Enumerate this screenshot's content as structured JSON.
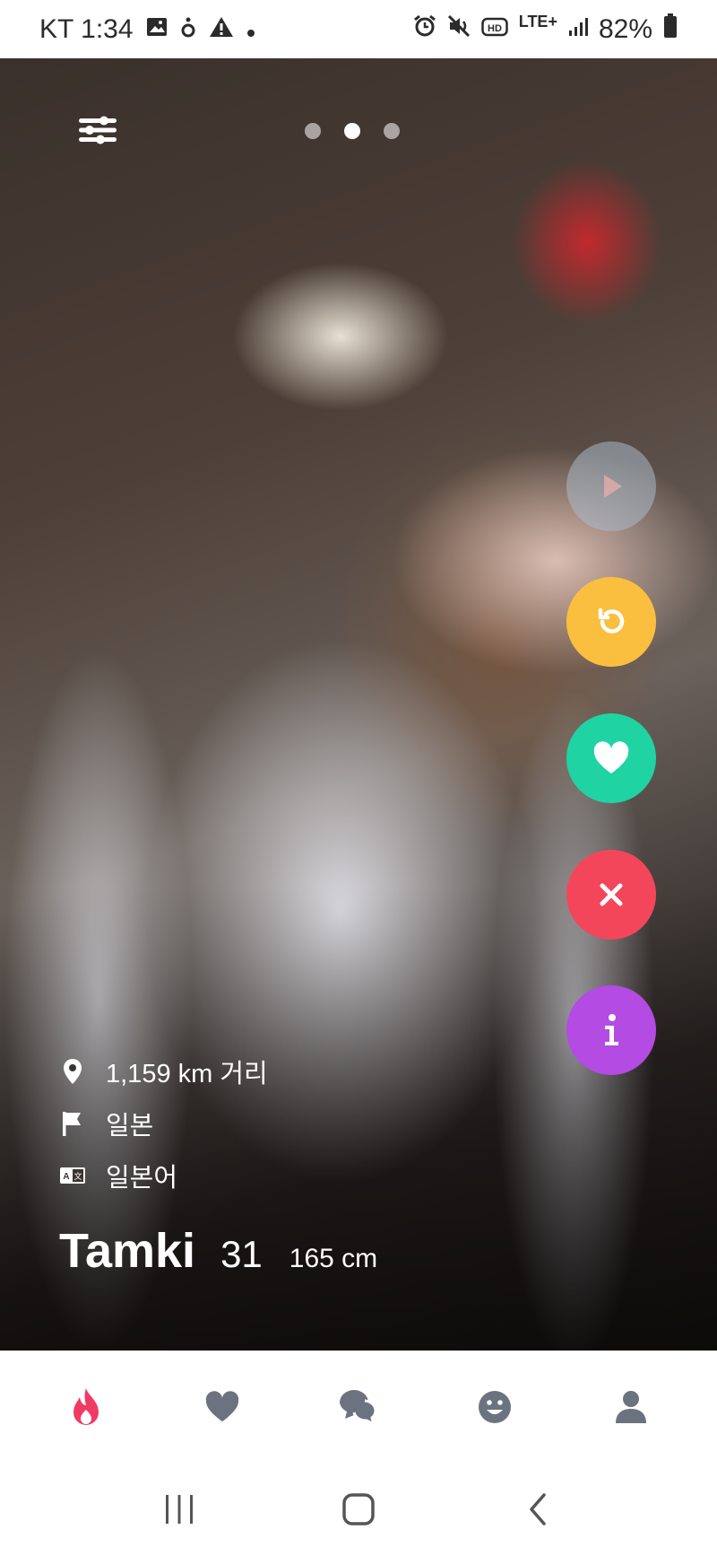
{
  "status_bar": {
    "carrier_time": "KT 1:34",
    "network": "LTE+",
    "battery": "82%"
  },
  "photo": {
    "page_indicator": {
      "count": 3,
      "active_index": 1
    }
  },
  "profile": {
    "distance": "1,159 km 거리",
    "country": "일본",
    "language": "일본어",
    "name": "Tamki",
    "age": "31",
    "height": "165 cm"
  },
  "colors": {
    "undo": "#fbbf3f",
    "like": "#20d3a3",
    "close": "#f4465b",
    "info": "#b44be2",
    "nav_active": "#ef3a64",
    "nav_inactive": "#6b7380"
  },
  "icons": {
    "filter": "sliders-icon",
    "undo": "undo-icon",
    "like": "heart-icon",
    "close": "close-icon",
    "info": "info-icon",
    "nav": [
      "flame-icon",
      "heart-icon",
      "chat-icon",
      "smiley-icon",
      "person-icon"
    ]
  }
}
